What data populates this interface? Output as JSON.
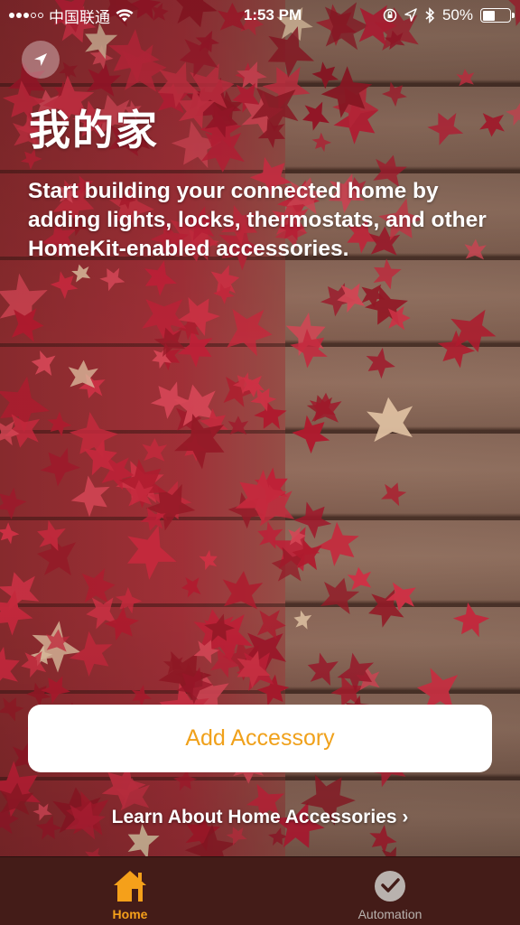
{
  "status_bar": {
    "carrier": "中国联通",
    "time": "1:53 PM",
    "battery_percent": "50%",
    "battery_level": 0.5,
    "signal_bars": 3
  },
  "header": {
    "title": "我的家",
    "location_icon": "location-arrow-icon"
  },
  "intro_text": "Start building your connected home by adding lights, locks, thermostats, and other HomeKit-enabled accessories.",
  "actions": {
    "add_accessory": "Add Accessory",
    "learn_more": "Learn About Home Accessories",
    "learn_more_chevron": "›"
  },
  "tab_bar": {
    "tabs": [
      {
        "label": "Home",
        "icon": "house-icon",
        "active": true
      },
      {
        "label": "Automation",
        "icon": "clock-check-icon",
        "active": false
      }
    ]
  },
  "colors": {
    "accent": "#f5a01a",
    "button_text": "#f0a11b",
    "tab_bar_bg": "#421c18",
    "inactive_tab": "#b9b2ae"
  }
}
